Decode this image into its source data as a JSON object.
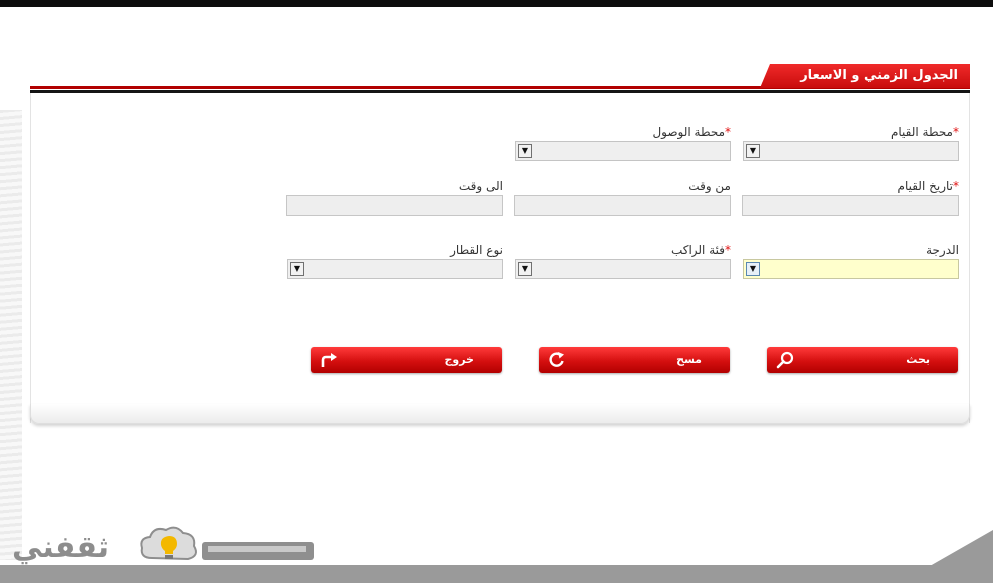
{
  "panel": {
    "title": "الجدول الزمني و الاسعار"
  },
  "form": {
    "departure_station": {
      "label": "محطة القيام",
      "required_mark": "*"
    },
    "arrival_station": {
      "label": "محطة الوصول",
      "required_mark": "*"
    },
    "departure_date": {
      "label": "تاريخ القيام",
      "required_mark": "*"
    },
    "from_time": {
      "label": "من وقت"
    },
    "to_time": {
      "label": "الى وقت"
    },
    "class": {
      "label": "الدرجة"
    },
    "passenger_category": {
      "label": "فئة الراكب",
      "required_mark": "*"
    },
    "train_type": {
      "label": "نوع القطار"
    }
  },
  "buttons": {
    "search": "بحث",
    "clear": "مسح",
    "exit": "خروج"
  },
  "colors": {
    "accent": "#d40f0f",
    "highlight_field": "#ffffcc"
  },
  "logo": {
    "text": "ثقفني",
    "icon": "lightbulb-cloud-icon"
  }
}
